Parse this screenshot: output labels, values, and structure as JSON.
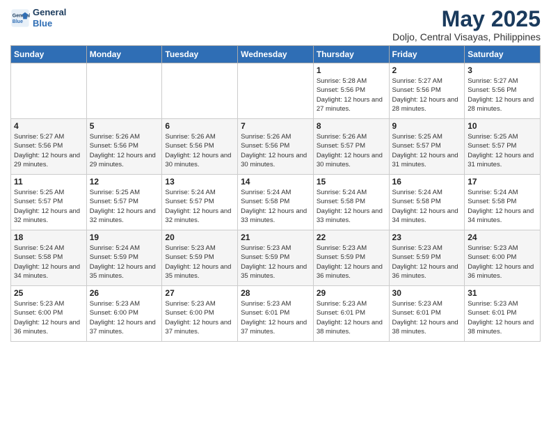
{
  "logo": {
    "line1": "General",
    "line2": "Blue"
  },
  "title": "May 2025",
  "subtitle": "Doljo, Central Visayas, Philippines",
  "days_of_week": [
    "Sunday",
    "Monday",
    "Tuesday",
    "Wednesday",
    "Thursday",
    "Friday",
    "Saturday"
  ],
  "weeks": [
    [
      {
        "day": "",
        "sunrise": "",
        "sunset": "",
        "daylight": ""
      },
      {
        "day": "",
        "sunrise": "",
        "sunset": "",
        "daylight": ""
      },
      {
        "day": "",
        "sunrise": "",
        "sunset": "",
        "daylight": ""
      },
      {
        "day": "",
        "sunrise": "",
        "sunset": "",
        "daylight": ""
      },
      {
        "day": "1",
        "sunrise": "Sunrise: 5:28 AM",
        "sunset": "Sunset: 5:56 PM",
        "daylight": "Daylight: 12 hours and 27 minutes."
      },
      {
        "day": "2",
        "sunrise": "Sunrise: 5:27 AM",
        "sunset": "Sunset: 5:56 PM",
        "daylight": "Daylight: 12 hours and 28 minutes."
      },
      {
        "day": "3",
        "sunrise": "Sunrise: 5:27 AM",
        "sunset": "Sunset: 5:56 PM",
        "daylight": "Daylight: 12 hours and 28 minutes."
      }
    ],
    [
      {
        "day": "4",
        "sunrise": "Sunrise: 5:27 AM",
        "sunset": "Sunset: 5:56 PM",
        "daylight": "Daylight: 12 hours and 29 minutes."
      },
      {
        "day": "5",
        "sunrise": "Sunrise: 5:26 AM",
        "sunset": "Sunset: 5:56 PM",
        "daylight": "Daylight: 12 hours and 29 minutes."
      },
      {
        "day": "6",
        "sunrise": "Sunrise: 5:26 AM",
        "sunset": "Sunset: 5:56 PM",
        "daylight": "Daylight: 12 hours and 30 minutes."
      },
      {
        "day": "7",
        "sunrise": "Sunrise: 5:26 AM",
        "sunset": "Sunset: 5:56 PM",
        "daylight": "Daylight: 12 hours and 30 minutes."
      },
      {
        "day": "8",
        "sunrise": "Sunrise: 5:26 AM",
        "sunset": "Sunset: 5:57 PM",
        "daylight": "Daylight: 12 hours and 30 minutes."
      },
      {
        "day": "9",
        "sunrise": "Sunrise: 5:25 AM",
        "sunset": "Sunset: 5:57 PM",
        "daylight": "Daylight: 12 hours and 31 minutes."
      },
      {
        "day": "10",
        "sunrise": "Sunrise: 5:25 AM",
        "sunset": "Sunset: 5:57 PM",
        "daylight": "Daylight: 12 hours and 31 minutes."
      }
    ],
    [
      {
        "day": "11",
        "sunrise": "Sunrise: 5:25 AM",
        "sunset": "Sunset: 5:57 PM",
        "daylight": "Daylight: 12 hours and 32 minutes."
      },
      {
        "day": "12",
        "sunrise": "Sunrise: 5:25 AM",
        "sunset": "Sunset: 5:57 PM",
        "daylight": "Daylight: 12 hours and 32 minutes."
      },
      {
        "day": "13",
        "sunrise": "Sunrise: 5:24 AM",
        "sunset": "Sunset: 5:57 PM",
        "daylight": "Daylight: 12 hours and 32 minutes."
      },
      {
        "day": "14",
        "sunrise": "Sunrise: 5:24 AM",
        "sunset": "Sunset: 5:58 PM",
        "daylight": "Daylight: 12 hours and 33 minutes."
      },
      {
        "day": "15",
        "sunrise": "Sunrise: 5:24 AM",
        "sunset": "Sunset: 5:58 PM",
        "daylight": "Daylight: 12 hours and 33 minutes."
      },
      {
        "day": "16",
        "sunrise": "Sunrise: 5:24 AM",
        "sunset": "Sunset: 5:58 PM",
        "daylight": "Daylight: 12 hours and 34 minutes."
      },
      {
        "day": "17",
        "sunrise": "Sunrise: 5:24 AM",
        "sunset": "Sunset: 5:58 PM",
        "daylight": "Daylight: 12 hours and 34 minutes."
      }
    ],
    [
      {
        "day": "18",
        "sunrise": "Sunrise: 5:24 AM",
        "sunset": "Sunset: 5:58 PM",
        "daylight": "Daylight: 12 hours and 34 minutes."
      },
      {
        "day": "19",
        "sunrise": "Sunrise: 5:24 AM",
        "sunset": "Sunset: 5:59 PM",
        "daylight": "Daylight: 12 hours and 35 minutes."
      },
      {
        "day": "20",
        "sunrise": "Sunrise: 5:23 AM",
        "sunset": "Sunset: 5:59 PM",
        "daylight": "Daylight: 12 hours and 35 minutes."
      },
      {
        "day": "21",
        "sunrise": "Sunrise: 5:23 AM",
        "sunset": "Sunset: 5:59 PM",
        "daylight": "Daylight: 12 hours and 35 minutes."
      },
      {
        "day": "22",
        "sunrise": "Sunrise: 5:23 AM",
        "sunset": "Sunset: 5:59 PM",
        "daylight": "Daylight: 12 hours and 36 minutes."
      },
      {
        "day": "23",
        "sunrise": "Sunrise: 5:23 AM",
        "sunset": "Sunset: 5:59 PM",
        "daylight": "Daylight: 12 hours and 36 minutes."
      },
      {
        "day": "24",
        "sunrise": "Sunrise: 5:23 AM",
        "sunset": "Sunset: 6:00 PM",
        "daylight": "Daylight: 12 hours and 36 minutes."
      }
    ],
    [
      {
        "day": "25",
        "sunrise": "Sunrise: 5:23 AM",
        "sunset": "Sunset: 6:00 PM",
        "daylight": "Daylight: 12 hours and 36 minutes."
      },
      {
        "day": "26",
        "sunrise": "Sunrise: 5:23 AM",
        "sunset": "Sunset: 6:00 PM",
        "daylight": "Daylight: 12 hours and 37 minutes."
      },
      {
        "day": "27",
        "sunrise": "Sunrise: 5:23 AM",
        "sunset": "Sunset: 6:00 PM",
        "daylight": "Daylight: 12 hours and 37 minutes."
      },
      {
        "day": "28",
        "sunrise": "Sunrise: 5:23 AM",
        "sunset": "Sunset: 6:01 PM",
        "daylight": "Daylight: 12 hours and 37 minutes."
      },
      {
        "day": "29",
        "sunrise": "Sunrise: 5:23 AM",
        "sunset": "Sunset: 6:01 PM",
        "daylight": "Daylight: 12 hours and 38 minutes."
      },
      {
        "day": "30",
        "sunrise": "Sunrise: 5:23 AM",
        "sunset": "Sunset: 6:01 PM",
        "daylight": "Daylight: 12 hours and 38 minutes."
      },
      {
        "day": "31",
        "sunrise": "Sunrise: 5:23 AM",
        "sunset": "Sunset: 6:01 PM",
        "daylight": "Daylight: 12 hours and 38 minutes."
      }
    ]
  ]
}
